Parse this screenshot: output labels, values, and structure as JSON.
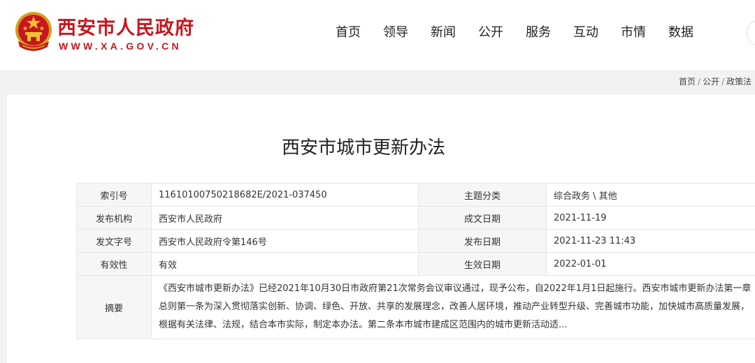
{
  "header": {
    "site_name": "西安市人民政府",
    "site_url": "WWW.XA.GOV.CN",
    "brand_color": "#c8161d",
    "nav": [
      "首页",
      "领导",
      "新闻",
      "公开",
      "服务",
      "互动",
      "市情",
      "数据"
    ]
  },
  "breadcrumb": [
    "首页",
    "公开",
    "政策法"
  ],
  "document": {
    "title": "西安市城市更新办法",
    "rows": [
      {
        "label1": "索引号",
        "value1": "11610100750218682E/2021-037450",
        "label2": "主题分类",
        "value2": "综合政务 \\ 其他"
      },
      {
        "label1": "发布机构",
        "value1": "西安市人民政府",
        "label2": "成文日期",
        "value2": "2021-11-19"
      },
      {
        "label1": "发文字号",
        "value1": "西安市人民政府令第146号",
        "label2": "发布日期",
        "value2": "2021-11-23 11:43"
      },
      {
        "label1": "有效性",
        "value1": "有效",
        "label2": "生效日期",
        "value2": "2022-01-01"
      }
    ],
    "summary_label": "摘要",
    "summary_text": "《西安市城市更新办法》已经2021年10月30日市政府第21次常务会议审议通过，现予公布，自2022年1月1日起施行。西安市城市更新办法第一章总则第一条为深入贯彻落实创新、协调、绿色、开放、共享的发展理念，改善人居环境，推动产业转型升级、完善城市功能，加快城市高质量发展，根据有关法律、法规，结合本市实际，制定本办法。第二条本市城市建成区范围内的城市更新活动适..."
  }
}
